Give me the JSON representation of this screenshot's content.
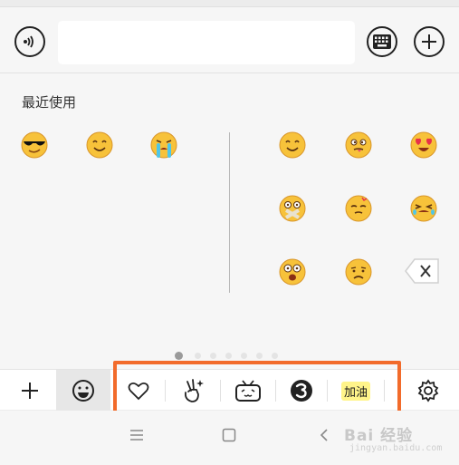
{
  "input_bar": {
    "text_value": "",
    "voice_icon": "voice-icon",
    "keyboard_icon": "keyboard-icon",
    "plus_icon": "plus-icon"
  },
  "emoji_panel": {
    "recent_label": "最近使用",
    "recent": [
      "cool-sunglasses",
      "smile",
      "crying"
    ],
    "grid": [
      "smile",
      "tongue-out",
      "heart-eyes",
      "tape-mouth",
      "dizzy",
      "wailing",
      "startled",
      "sad"
    ],
    "delete_icon": "backspace-icon",
    "page_count": 6,
    "active_page": 0
  },
  "tabbar": {
    "tabs": [
      {
        "icon": "add-icon"
      },
      {
        "icon": "smiley-icon",
        "selected": true
      },
      {
        "icon": "heart-icon"
      },
      {
        "icon": "victory-hand-icon"
      },
      {
        "icon": "bilibili-tv-icon"
      },
      {
        "icon": "swirl-3-icon"
      },
      {
        "label": "加油"
      },
      {
        "icon": "settings-icon"
      }
    ]
  },
  "nav": {
    "menu_icon": "menu-icon",
    "home_icon": "home-icon",
    "back_icon": "back-icon"
  },
  "watermark": {
    "main": "Bai 经验",
    "sub": "jingyan.baidu.com"
  },
  "colors": {
    "highlight": "#f26b2b",
    "emoji_face": "#f7c23a",
    "panel_bg": "#f6f6f6"
  }
}
